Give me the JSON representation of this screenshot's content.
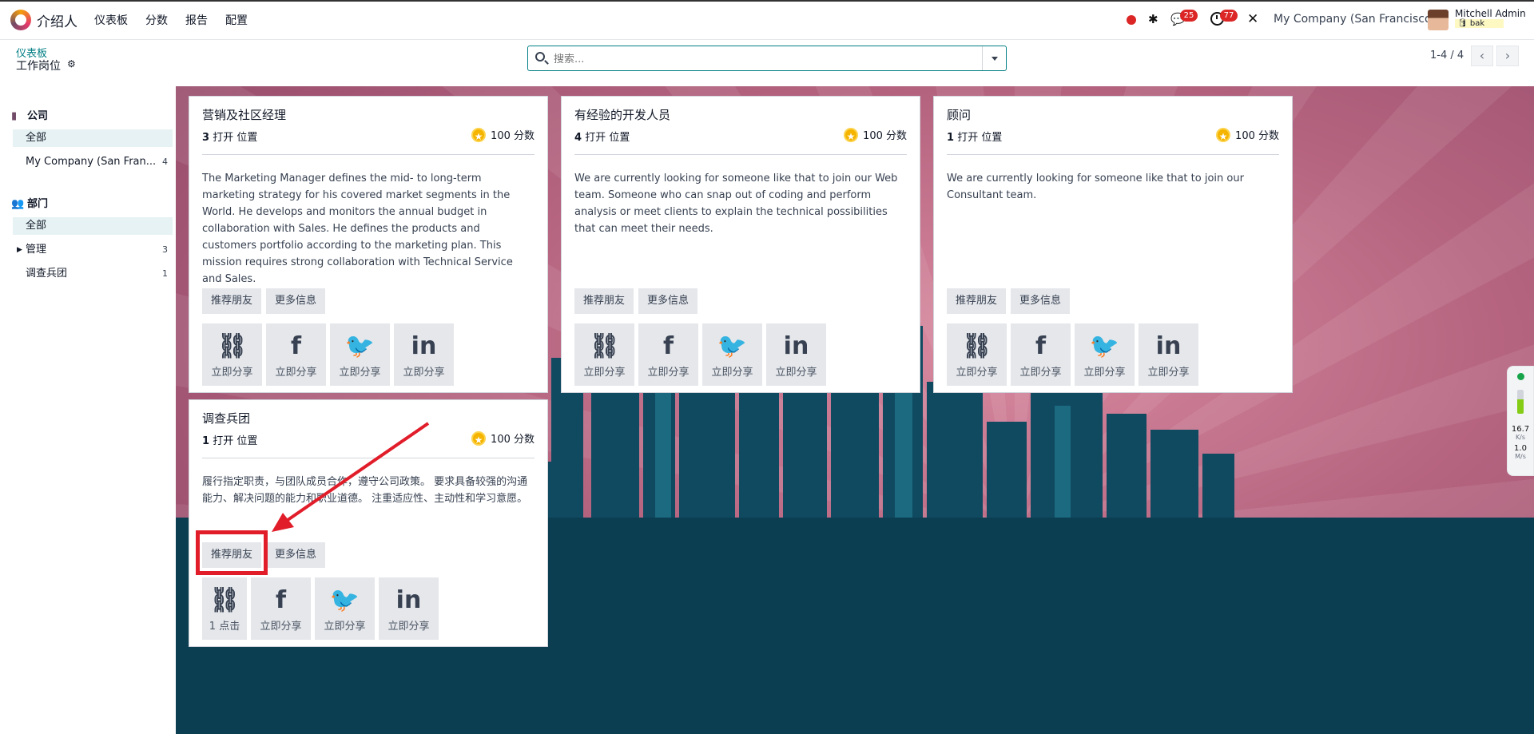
{
  "navbar": {
    "app_name": "介绍人",
    "menu": [
      "仪表板",
      "分数",
      "报告",
      "配置"
    ],
    "chat_badge": "25",
    "activity_badge": "77",
    "company": "My Company (San Francisco)",
    "user_name": "Mitchell Admin",
    "user_db": "bak"
  },
  "control_panel": {
    "breadcrumb_parent": "仪表板",
    "breadcrumb_current": "工作岗位",
    "search_placeholder": "搜索...",
    "pager": "1-4 / 4"
  },
  "sidebar": {
    "company_title": "公司",
    "company_items": [
      {
        "label": "全部",
        "count": ""
      },
      {
        "label": "My Company (San Fran...",
        "count": "4"
      }
    ],
    "department_title": "部门",
    "department_items": [
      {
        "label": "全部",
        "count": ""
      },
      {
        "label": "管理",
        "count": "3"
      },
      {
        "label": "调查兵团",
        "count": "1"
      }
    ]
  },
  "cards": [
    {
      "title": "营销及社区经理",
      "openings_num": "3",
      "openings_text": "打开 位置",
      "points": "100 分数",
      "description": "The Marketing Manager defines the mid- to long-term marketing strategy for his covered market segments in the World. He develops and monitors the annual budget in collaboration with Sales. He defines the products and customers portfolio according to the marketing plan. This mission requires strong collaboration with Technical Service and Sales.",
      "refer_label": "推荐朋友",
      "more_label": "更多信息",
      "shares": [
        "立即分享",
        "立即分享",
        "立即分享",
        "立即分享"
      ]
    },
    {
      "title": "有经验的开发人员",
      "openings_num": "4",
      "openings_text": "打开 位置",
      "points": "100 分数",
      "description": "We are currently looking for someone like that to join our Web team. Someone who can snap out of coding and perform analysis or meet clients to explain the technical possibilities that can meet their needs.",
      "refer_label": "推荐朋友",
      "more_label": "更多信息",
      "shares": [
        "立即分享",
        "立即分享",
        "立即分享",
        "立即分享"
      ]
    },
    {
      "title": "顾问",
      "openings_num": "1",
      "openings_text": "打开 位置",
      "points": "100 分数",
      "description": "We are currently looking for someone like that to join our Consultant team.",
      "refer_label": "推荐朋友",
      "more_label": "更多信息",
      "shares": [
        "立即分享",
        "立即分享",
        "立即分享",
        "立即分享"
      ]
    },
    {
      "title": "调查兵团",
      "openings_num": "1",
      "openings_text": "打开 位置",
      "points": "100 分数",
      "description": "履行指定职责，与团队成员合作，遵守公司政策。 要求具备较强的沟通能力、解决问题的能力和职业道德。 注重适应性、主动性和学习意愿。",
      "refer_label": "推荐朋友",
      "more_label": "更多信息",
      "shares": [
        "1 点击",
        "立即分享",
        "立即分享",
        "立即分享"
      ]
    }
  ],
  "share_icons": [
    "link-icon",
    "facebook-icon",
    "twitter-icon",
    "linkedin-icon"
  ],
  "net_widget": {
    "down": "16.7",
    "down_unit": "K/s",
    "up": "1.0",
    "up_unit": "M/s"
  },
  "colors": {
    "accent": "#017e84",
    "highlight": "#e11d2a",
    "badge": "#dc2626"
  }
}
